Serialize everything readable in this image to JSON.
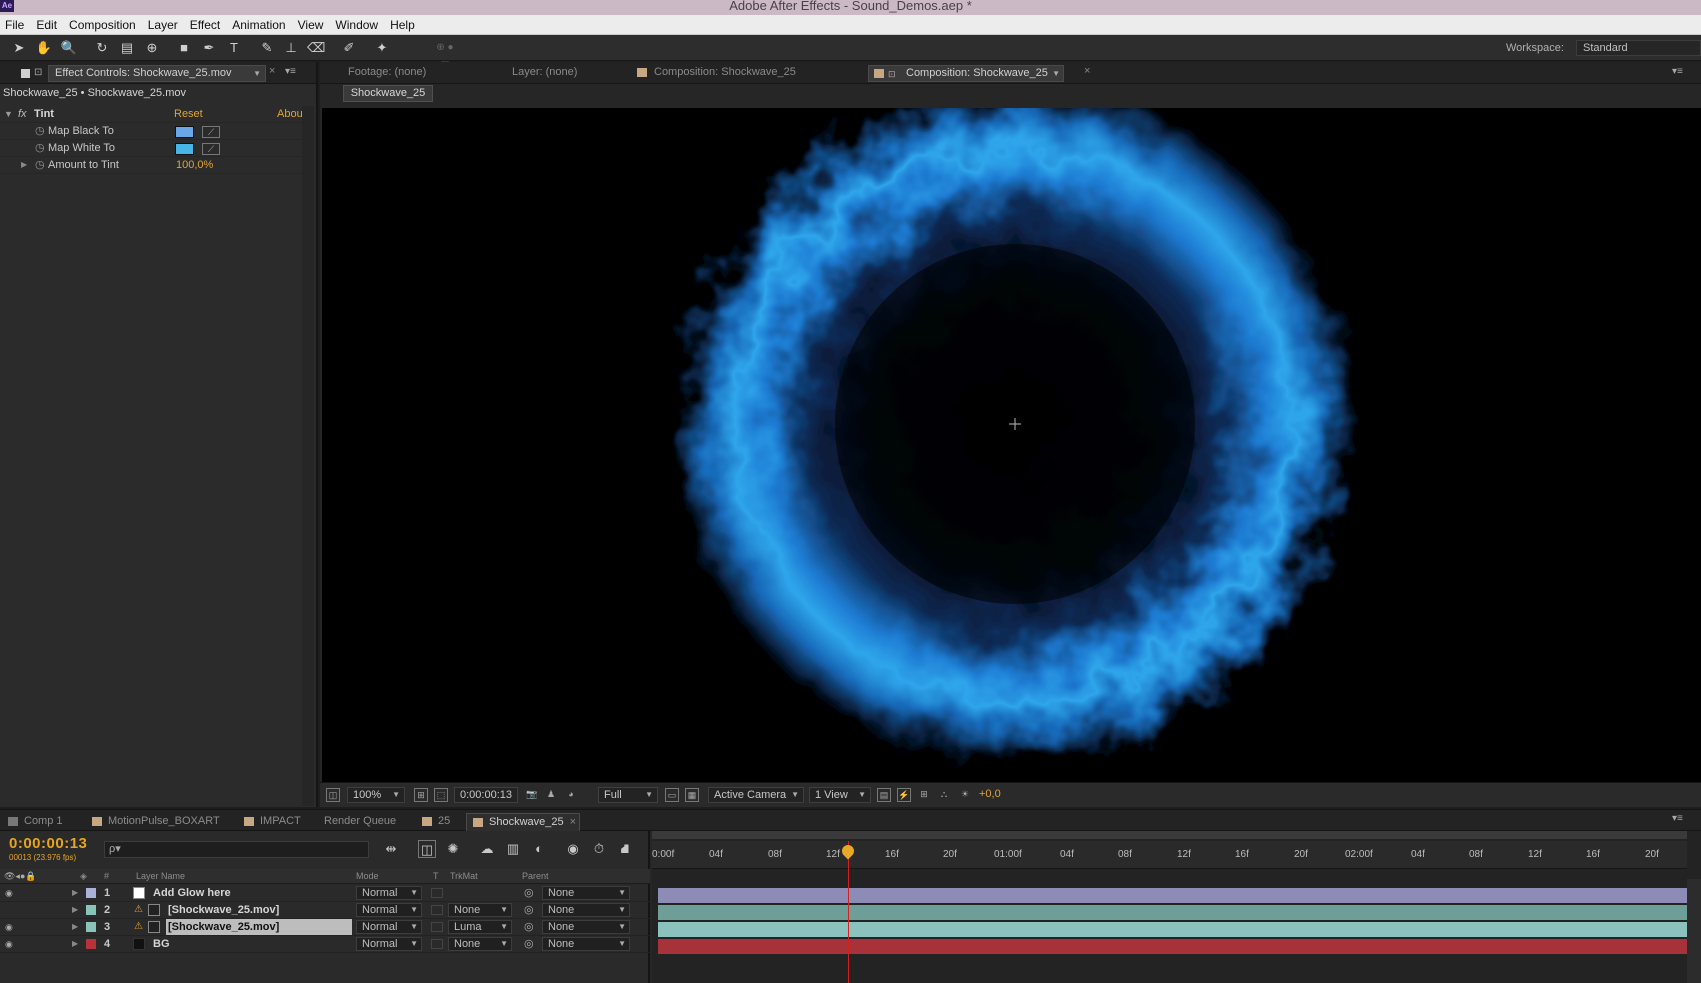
{
  "window": {
    "title": "Adobe After Effects - Sound_Demos.aep *",
    "app_badge": "Ae"
  },
  "menu": [
    "File",
    "Edit",
    "Composition",
    "Layer",
    "Effect",
    "Animation",
    "View",
    "Window",
    "Help"
  ],
  "toolbar": {
    "workspace_label": "Workspace:",
    "workspace_value": "Standard"
  },
  "effect_controls": {
    "tab_label": "Effect Controls: Shockwave_25.mov",
    "subtitle": "Shockwave_25 • Shockwave_25.mov",
    "effect_name": "Tint",
    "reset": "Reset",
    "about": "Abou",
    "fx": "fx",
    "properties": [
      {
        "label": "Map Black To",
        "color": "#6aa7e8"
      },
      {
        "label": "Map White To",
        "color": "#46b6e8"
      },
      {
        "label": "Amount to Tint",
        "value": "100,0%"
      }
    ]
  },
  "viewer": {
    "tabs": [
      {
        "label": "Footage: (none)"
      },
      {
        "label": "Layer: (none)"
      },
      {
        "label": "Composition: Shockwave_25"
      },
      {
        "label": "Composition: Shockwave_25"
      }
    ],
    "crumb": "Shockwave_25",
    "controls": {
      "zoom": "100%",
      "time": "0:00:00:13",
      "resolution": "Full",
      "camera": "Active Camera",
      "views": "1 View",
      "exposure": "+0,0"
    }
  },
  "timeline": {
    "tabs": [
      "Comp 1",
      "MotionPulse_BOXART",
      "IMPACT",
      "Render Queue",
      "25",
      "Shockwave_25"
    ],
    "timecode": "0:00:00:13",
    "fps": "00013 (23.976 fps)",
    "search_placeholder": "ρ▾",
    "headers": {
      "hash": "#",
      "layer_name": "Layer Name",
      "mode": "Mode",
      "t": "T",
      "trkmat": "TrkMat",
      "parent": "Parent"
    },
    "ruler": [
      "0:00f",
      "04f",
      "08f",
      "12f",
      "16f",
      "20f",
      "01:00f",
      "04f",
      "08f",
      "12f",
      "16f",
      "20f",
      "02:00f",
      "04f",
      "08f",
      "12f",
      "16f",
      "20f"
    ],
    "playhead_time": "0:00:00:13",
    "layers": [
      {
        "num": "1",
        "name": "Add Glow here",
        "mode": "Normal",
        "trkmat": "",
        "parent": "None",
        "label_color": "#a9b3d8",
        "bar_color": "#8d8cb7"
      },
      {
        "num": "2",
        "name": "[Shockwave_25.mov]",
        "mode": "Normal",
        "trkmat": "None",
        "parent": "None",
        "label_color": "#89c4b8",
        "bar_color": "#6d9e98"
      },
      {
        "num": "3",
        "name": "[Shockwave_25.mov]",
        "mode": "Normal",
        "trkmat": "Luma",
        "parent": "None",
        "label_color": "#89c4b8",
        "bar_color": "#8cc2bd"
      },
      {
        "num": "4",
        "name": "BG",
        "mode": "Normal",
        "trkmat": "None",
        "parent": "None",
        "label_color": "#b8323a",
        "bar_color": "#a8323a"
      }
    ]
  }
}
